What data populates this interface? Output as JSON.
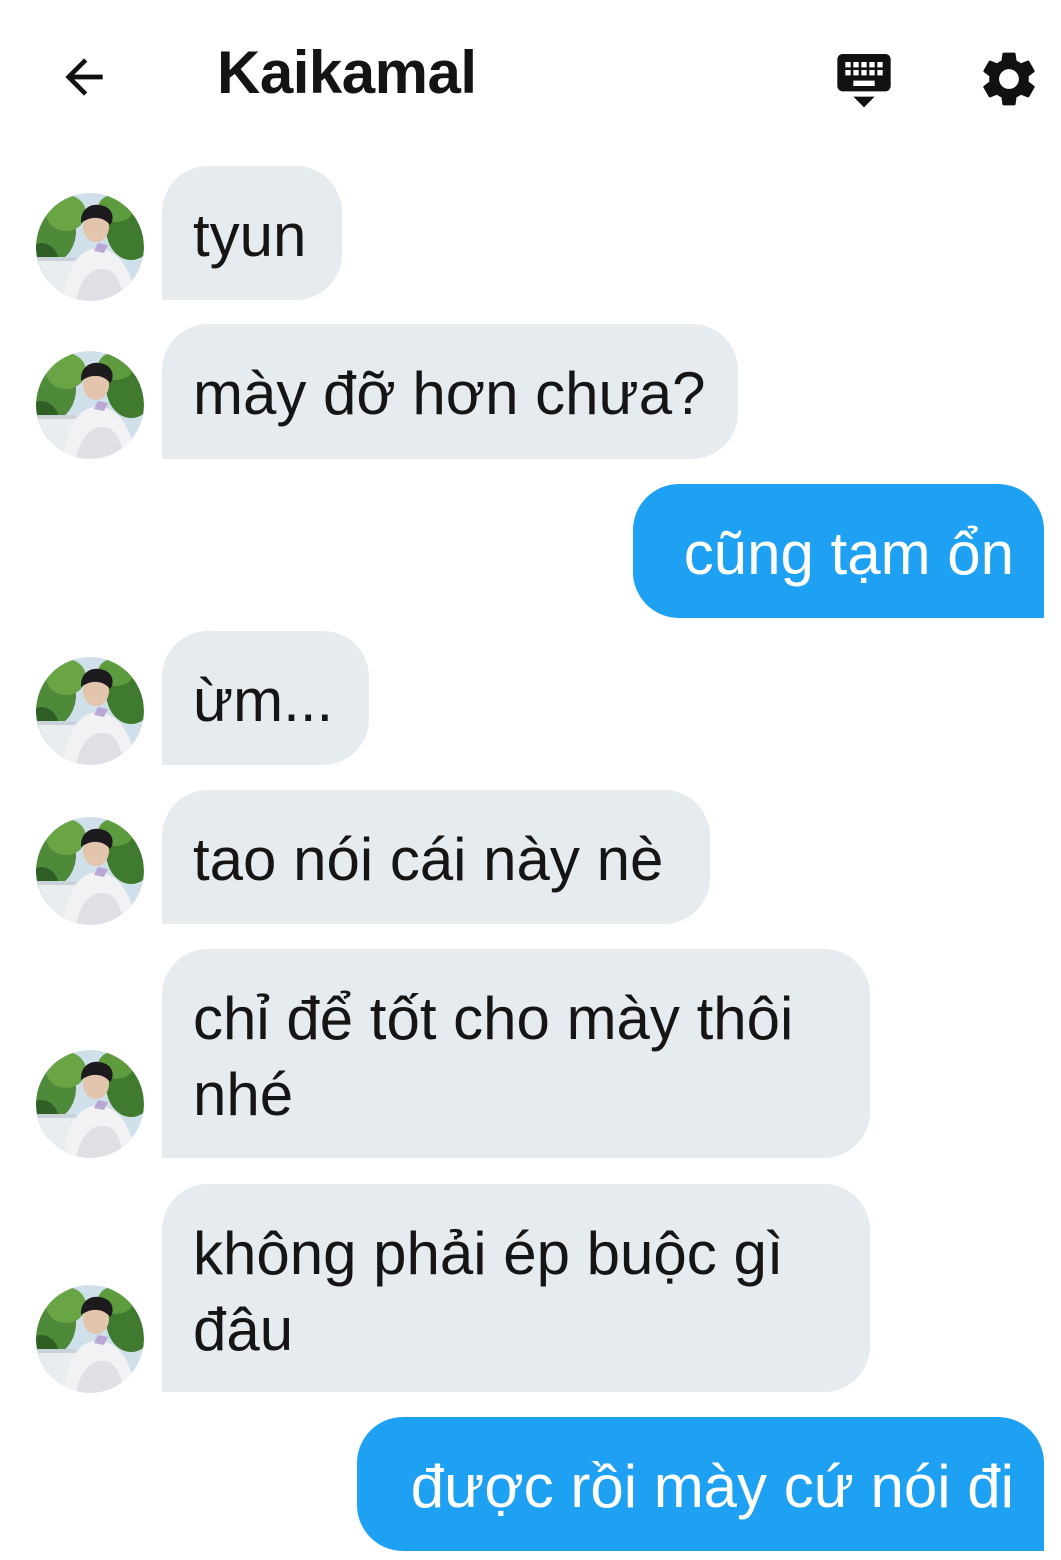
{
  "header": {
    "title": "Kaikamal",
    "back_icon": "arrow-left-icon",
    "keyboard_icon": "keyboard-hide-icon",
    "settings_icon": "gear-icon"
  },
  "colors": {
    "incoming_bubble": "#e6ebef",
    "outgoing_bubble": "#1ea1f2",
    "incoming_text": "#151515",
    "outgoing_text": "#ffffff",
    "title": "#141414"
  },
  "messages": [
    {
      "direction": "in",
      "lines": [
        "tyun"
      ]
    },
    {
      "direction": "in",
      "lines": [
        "mày đỡ hơn chưa?"
      ]
    },
    {
      "direction": "out",
      "lines": [
        "cũng tạm ổn"
      ]
    },
    {
      "direction": "in",
      "lines": [
        "ừm..."
      ]
    },
    {
      "direction": "in",
      "lines": [
        "tao nói cái này nè"
      ]
    },
    {
      "direction": "in",
      "lines": [
        "chỉ để tốt cho mày thôi",
        "nhé"
      ]
    },
    {
      "direction": "in",
      "lines": [
        "không phải ép buộc gì",
        "đâu"
      ]
    },
    {
      "direction": "out",
      "lines": [
        "được rồi mày cứ nói đi"
      ]
    }
  ]
}
